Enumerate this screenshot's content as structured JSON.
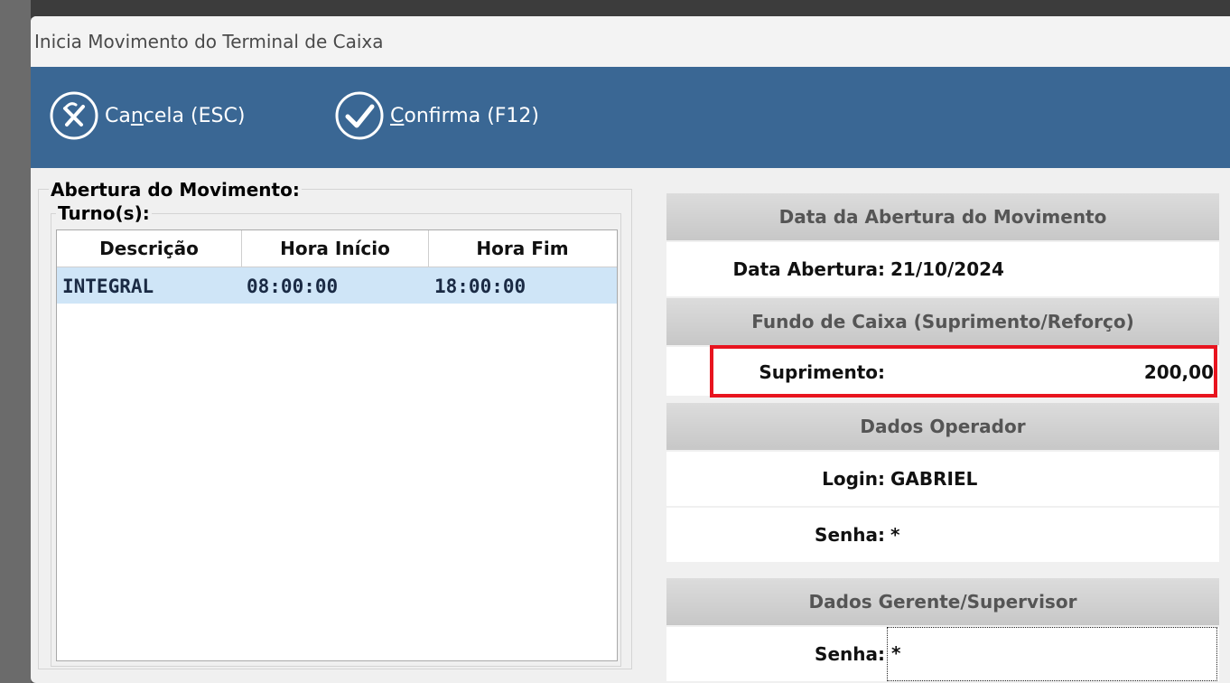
{
  "window": {
    "title": "Inicia Movimento do Terminal de Caixa"
  },
  "toolbar": {
    "cancel_pre": "Ca",
    "cancel_key": "n",
    "cancel_post": "cela (ESC)",
    "confirm_key": "C",
    "confirm_post": "onfirma (F12)"
  },
  "left": {
    "group_title": "Abertura do Movimento:",
    "shifts_title": "Turno(s):",
    "columns": [
      "Descrição",
      "Hora Início",
      "Hora Fim"
    ],
    "rows": [
      [
        "INTEGRAL",
        "08:00:00",
        "18:00:00"
      ]
    ]
  },
  "right": {
    "date_section": "Data da Abertura do Movimento",
    "date_label": "Data Abertura:",
    "date_value": "21/10/2024",
    "fund_section": "Fundo de Caixa (Suprimento/Reforço)",
    "supply_label": "Suprimento:",
    "supply_value": "200,00",
    "operator_section": "Dados Operador",
    "login_label": "Login:",
    "login_value": "GABRIEL",
    "op_password_label": "Senha:",
    "op_password_value": "*",
    "manager_section": "Dados Gerente/Supervisor",
    "mgr_password_label": "Senha:",
    "mgr_password_value": "*"
  },
  "colors": {
    "toolbar": "#3a6794",
    "highlight": "#e8141f",
    "selected_row": "#cfe5f7"
  }
}
